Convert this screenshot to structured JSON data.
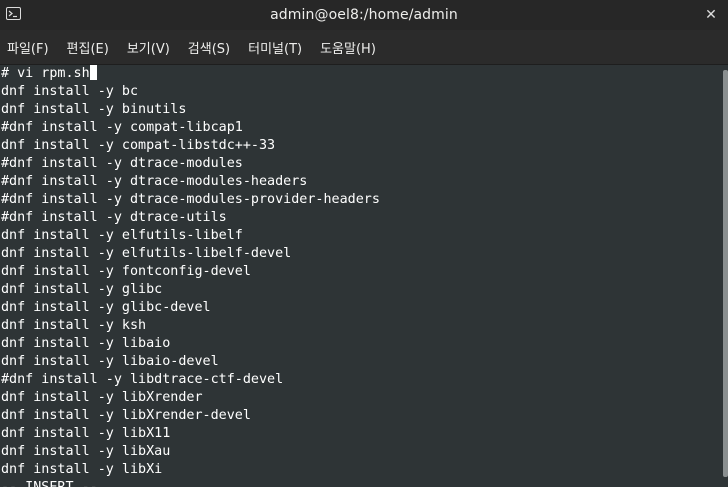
{
  "window": {
    "title": "admin@oel8:/home/admin",
    "close_glyph": "✕",
    "icon": "terminal-icon"
  },
  "menubar": {
    "items": [
      "파일(F)",
      "편집(E)",
      "보기(V)",
      "검색(S)",
      "터미널(T)",
      "도움말(H)"
    ]
  },
  "terminal": {
    "lines": [
      "# vi rpm.sh",
      "dnf install -y bc",
      "dnf install -y binutils",
      "#dnf install -y compat-libcap1",
      "dnf install -y compat-libstdc++-33",
      "#dnf install -y dtrace-modules",
      "#dnf install -y dtrace-modules-headers",
      "#dnf install -y dtrace-modules-provider-headers",
      "#dnf install -y dtrace-utils",
      "dnf install -y elfutils-libelf",
      "dnf install -y elfutils-libelf-devel",
      "dnf install -y fontconfig-devel",
      "dnf install -y glibc",
      "dnf install -y glibc-devel",
      "dnf install -y ksh",
      "dnf install -y libaio",
      "dnf install -y libaio-devel",
      "#dnf install -y libdtrace-ctf-devel",
      "dnf install -y libXrender",
      "dnf install -y libXrender-devel",
      "dnf install -y libX11",
      "dnf install -y libXau",
      "dnf install -y libXi",
      "-- INSERT --"
    ]
  },
  "colors": {
    "terminal_bg": "#2e3436",
    "terminal_fg": "#ffffff",
    "titlebar_bg": "#272727",
    "menubar_bg": "#2b2b2b"
  }
}
